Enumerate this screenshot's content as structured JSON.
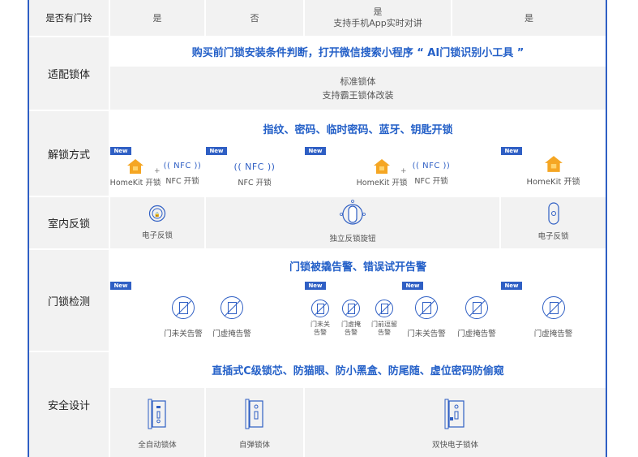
{
  "colors": {
    "accent": "#2f5fc4",
    "header_text": "#2460c8",
    "label_bg": "#f2f2f2",
    "badge": "#2f5fc4"
  },
  "rows": {
    "doorbell": {
      "label": "是否有门铃",
      "values": [
        "是",
        "否",
        "是",
        "支持手机App实时对讲",
        "是"
      ]
    },
    "lock_body": {
      "label": "适配锁体",
      "banner": "购买前门锁安装条件判断，打开微信搜索小程序 “ AI门锁识别小工具 ”",
      "lines": [
        "标准锁体",
        "支持霸王锁体改装"
      ]
    },
    "unlock": {
      "label": "解锁方式",
      "banner": "指纹、密码、临时密码、蓝牙、钥匙开锁",
      "badge": "New",
      "homekit_label": "HomeKit 开锁",
      "nfc_logo": "(( NFC ))",
      "nfc_label": "NFC 开锁",
      "plus": "+",
      "icons": [
        "homekit-house-icon",
        "nfc-icon"
      ]
    },
    "indoor": {
      "label": "室内反锁",
      "items": [
        "电子反锁",
        "独立反锁旋钮",
        "电子反锁"
      ]
    },
    "detect": {
      "label": "门锁检测",
      "banner": "门锁被撬告警、错误试开告警",
      "badge": "New",
      "big": [
        "门未关告警",
        "门虚掩告警"
      ],
      "small": [
        "门未关告警",
        "门虚掩告警",
        "门前逗留告警"
      ],
      "single": "门虚掩告警"
    },
    "safety": {
      "label": "安全设计",
      "banner": "直插式C级锁芯、防猫眼、防小黑盒、防尾随、虚位密码防偷窥",
      "items": [
        "全自动锁体",
        "自弹锁体",
        "双快电子锁体"
      ]
    }
  }
}
